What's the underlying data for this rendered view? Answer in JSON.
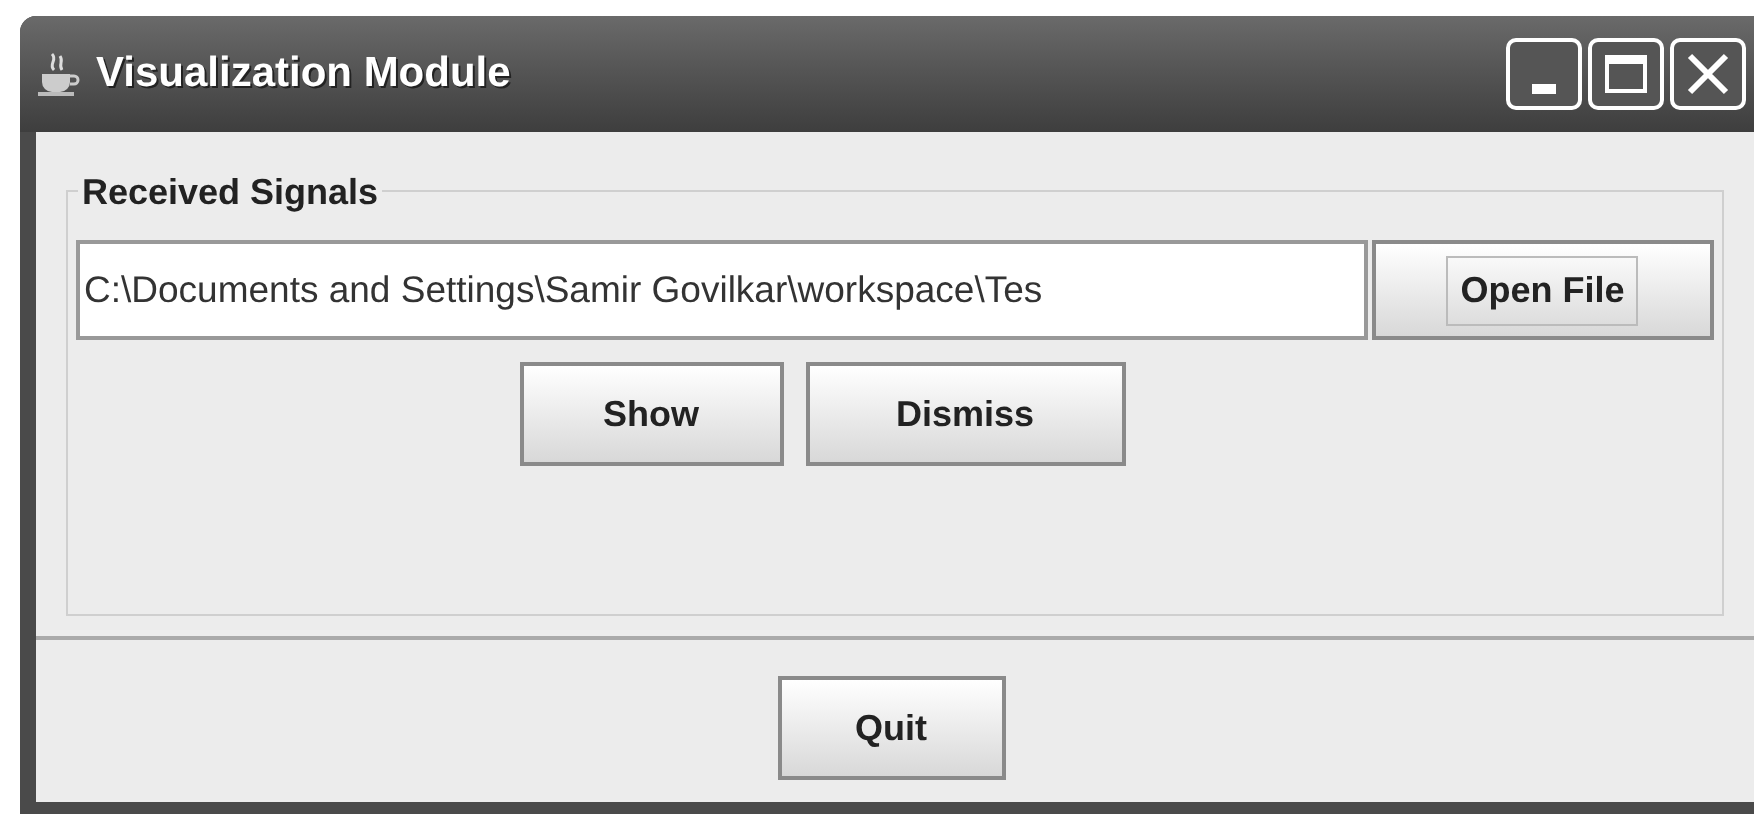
{
  "window": {
    "title": "Visualization Module"
  },
  "group": {
    "title": "Received Signals",
    "file_field": {
      "value": "C:\\Documents and Settings\\Samir Govilkar\\workspace\\Tes"
    },
    "open_button": {
      "label": "Open File",
      "focused": true
    },
    "buttons": [
      {
        "label": "Show",
        "focused": false
      },
      {
        "label": "Dismiss",
        "focused": false
      }
    ]
  },
  "footer": {
    "buttons": [
      {
        "label": "Quit",
        "focused": false
      }
    ]
  }
}
